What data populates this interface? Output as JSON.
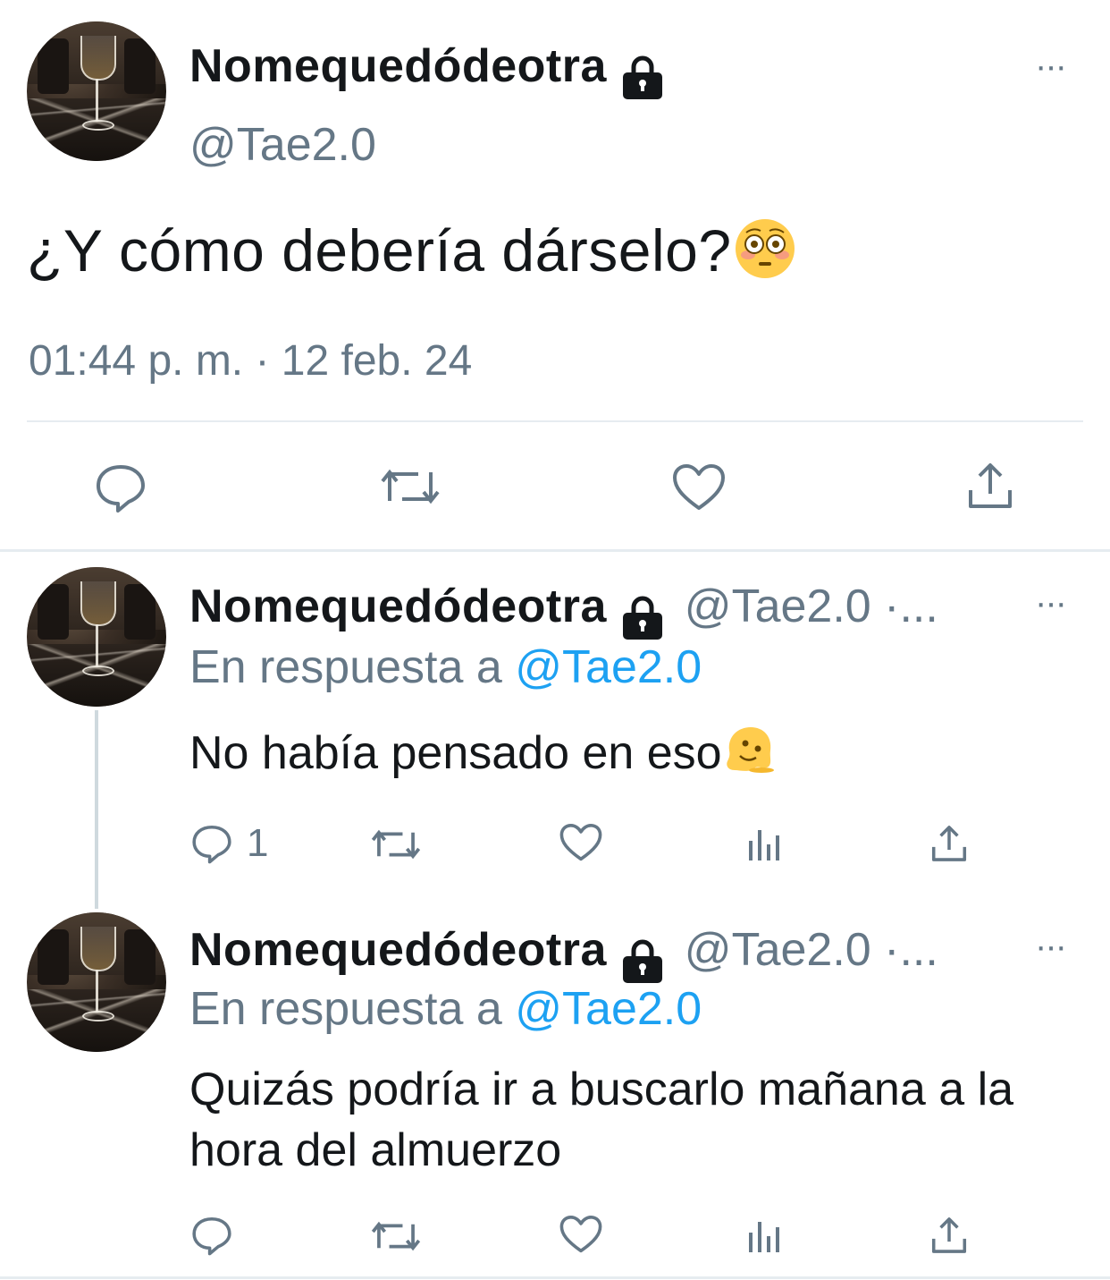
{
  "main_tweet": {
    "display_name": "Nomequedódeotra",
    "handle": "@Tae2.0",
    "text": "¿Y cómo debería dárselo?",
    "timestamp": "01:44 p. m. · 12 feb. 24",
    "more": "···"
  },
  "replies": [
    {
      "display_name": "Nomequedódeotra",
      "handle_truncated": "@Tae2.0 ·...",
      "replying_prefix": "En respuesta a",
      "replying_to": "@Tae2.0",
      "text": "No había pensado en eso",
      "reply_count": "1",
      "more": "···"
    },
    {
      "display_name": "Nomequedódeotra",
      "handle_truncated": "@Tae2.0 ·...",
      "replying_prefix": "En respuesta a",
      "replying_to": "@Tae2.0",
      "text": "Quizás podría ir a buscarlo mañana a la hora del almuerzo",
      "more": "···"
    }
  ],
  "icons": [
    "lock-icon",
    "reply-icon",
    "retweet-icon",
    "like-icon",
    "share-icon",
    "analytics-icon",
    "more-icon",
    "flushed-face-emoji",
    "melting-face-emoji"
  ],
  "colors": {
    "text": "#14171a",
    "secondary": "#657786",
    "link": "#1da1f2",
    "divider": "#e6ecf0"
  }
}
